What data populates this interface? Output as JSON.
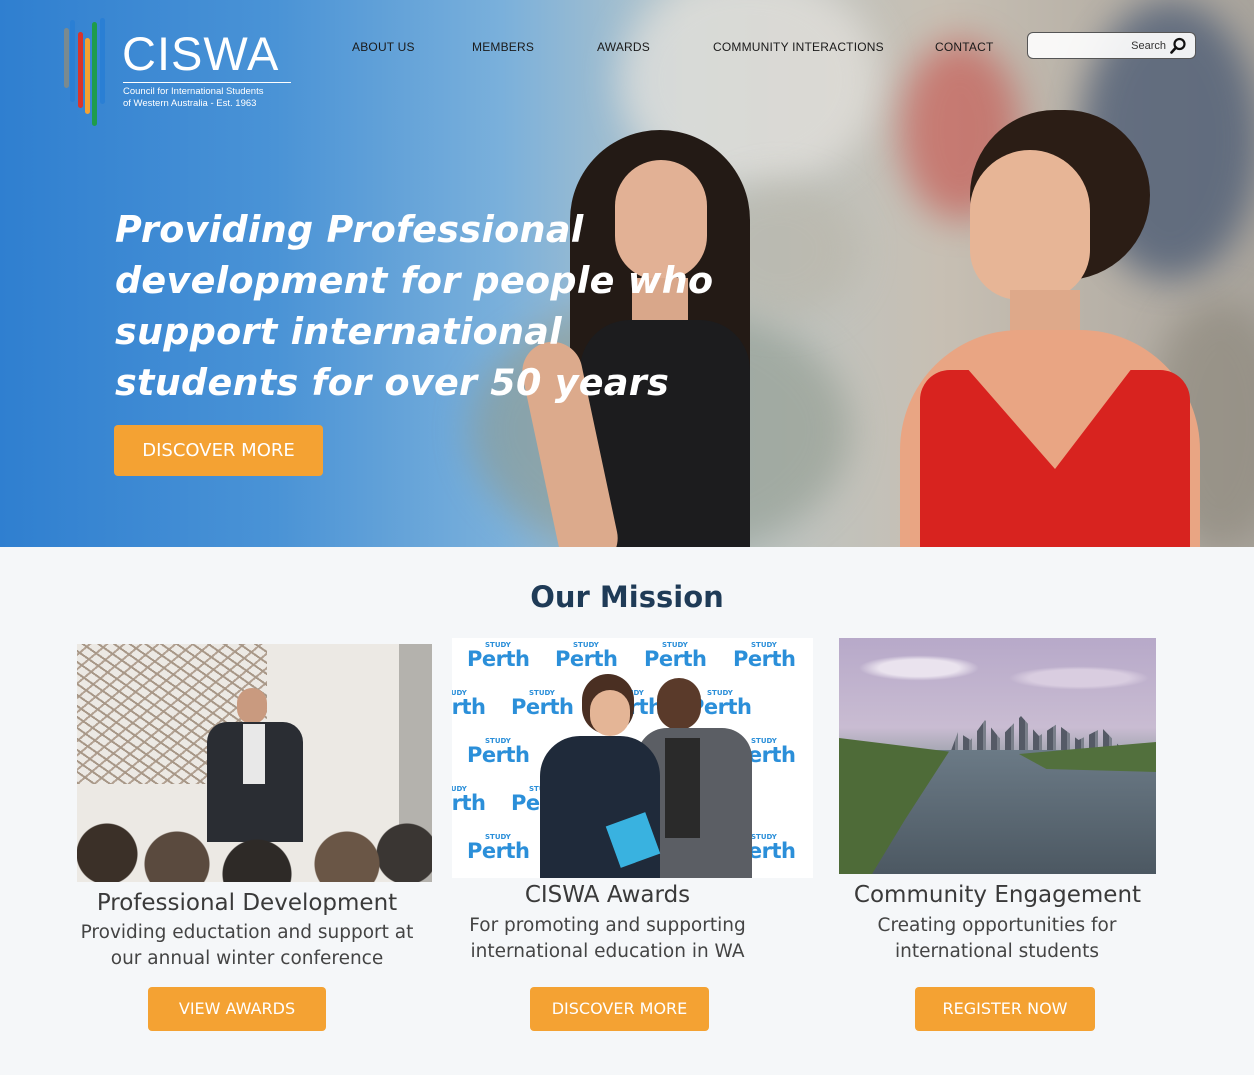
{
  "logo": {
    "wordmark": "CISWA",
    "subtitle_line1": "Council for International Students",
    "subtitle_line2": "of Western Australia  -  Est. 1963",
    "bar_colors": [
      "#7a8a8f",
      "#2a7fd4",
      "#d9342b",
      "#f4a233",
      "#1f9c4a",
      "#2a7fd4"
    ]
  },
  "nav": {
    "items": [
      "ABOUT US",
      "MEMBERS",
      "AWARDS",
      "COMMUNITY INTERACTIONS",
      "CONTACT"
    ]
  },
  "search": {
    "placeholder": "Search",
    "icon": "magnifier-icon"
  },
  "hero": {
    "title": "Providing Professional development for people who support international students for over 50 years",
    "button_label": "DISCOVER MORE"
  },
  "mission": {
    "title": "Our Mission",
    "cards": [
      {
        "title": "Professional Development",
        "description": "Providing eductation and support at our annual winter conference",
        "button_label": "VIEW AWARDS"
      },
      {
        "title": "CISWA Awards",
        "description": "For promoting and supporting international education in WA",
        "button_label": "DISCOVER MORE",
        "backdrop_word": "Perth",
        "backdrop_small": "STUDY"
      },
      {
        "title": "Community Engagement",
        "description": "Creating opportunities for international students",
        "button_label": "REGISTER NOW"
      }
    ]
  },
  "colors": {
    "accent": "#f4a233",
    "heading": "#1f3b57",
    "hero_blue": "#2f7fd0"
  }
}
